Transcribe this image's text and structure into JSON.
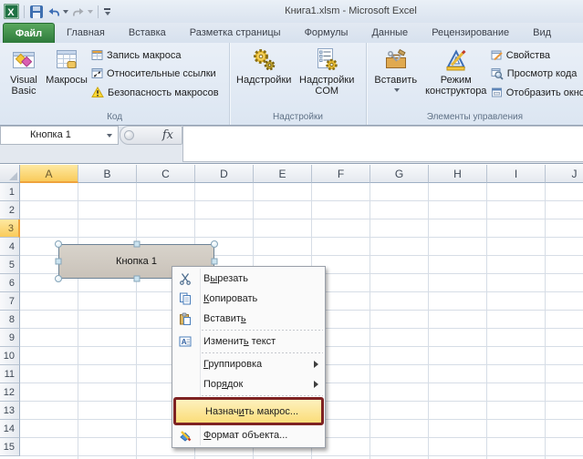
{
  "window": {
    "title": "Книга1.xlsm - Microsoft Excel"
  },
  "qat": {
    "icons": [
      "excel-logo",
      "save",
      "undo",
      "redo",
      "customize-quick-access-toolbar"
    ]
  },
  "tabs": [
    {
      "label": "Файл",
      "active": true
    },
    {
      "label": "Главная"
    },
    {
      "label": "Вставка"
    },
    {
      "label": "Разметка страницы"
    },
    {
      "label": "Формулы"
    },
    {
      "label": "Данные"
    },
    {
      "label": "Рецензирование"
    },
    {
      "label": "Вид"
    }
  ],
  "ribbon": {
    "code_group": {
      "label": "Код",
      "visual_basic": "Visual Basic",
      "macros": "Макросы",
      "record_macro": "Запись макроса",
      "relative_refs": "Относительные ссылки",
      "macro_security": "Безопасность макросов"
    },
    "addins_group": {
      "label": "Надстройки",
      "addins": "Надстройки",
      "com_addins": "Надстройки COM"
    },
    "controls_group": {
      "label": "Элементы управления",
      "insert": "Вставить",
      "design_mode": "Режим конструктора",
      "properties": "Свойства",
      "view_code": "Просмотр кода",
      "show_window": "Отобразить окно"
    }
  },
  "formula_bar": {
    "name_box": "Кнопка 1",
    "fx": "fx"
  },
  "grid": {
    "columns": [
      "A",
      "B",
      "C",
      "D",
      "E",
      "F",
      "G",
      "H",
      "I",
      "J"
    ],
    "rows": [
      "1",
      "2",
      "3",
      "4",
      "5",
      "6",
      "7",
      "8",
      "9",
      "10",
      "11",
      "12",
      "13",
      "14",
      "15"
    ],
    "selected_column": "A",
    "selected_row": "3"
  },
  "shape_button": {
    "label": "Кнопка 1"
  },
  "context_menu": {
    "items": [
      {
        "pre": "В",
        "key": "ы",
        "post": "резать"
      },
      {
        "pre": "",
        "key": "К",
        "post": "опировать"
      },
      {
        "pre": "Вставит",
        "key": "ь",
        "post": ""
      },
      {
        "pre": "Изменит",
        "key": "ь",
        "post": " текст"
      },
      {
        "pre": "",
        "key": "Г",
        "post": "руппировка"
      },
      {
        "pre": "Пор",
        "key": "я",
        "post": "док"
      },
      {
        "pre": "Назнач",
        "key": "и",
        "post": "ть макрос..."
      },
      {
        "pre": "",
        "key": "Ф",
        "post": "ормат объекта..."
      }
    ]
  },
  "colors": {
    "file_tab_green": "#2E7B3C",
    "selection_amber": "#F9CB5B",
    "annotation_red": "#7E2222",
    "shape_button_fill": "#CFC8C0"
  }
}
